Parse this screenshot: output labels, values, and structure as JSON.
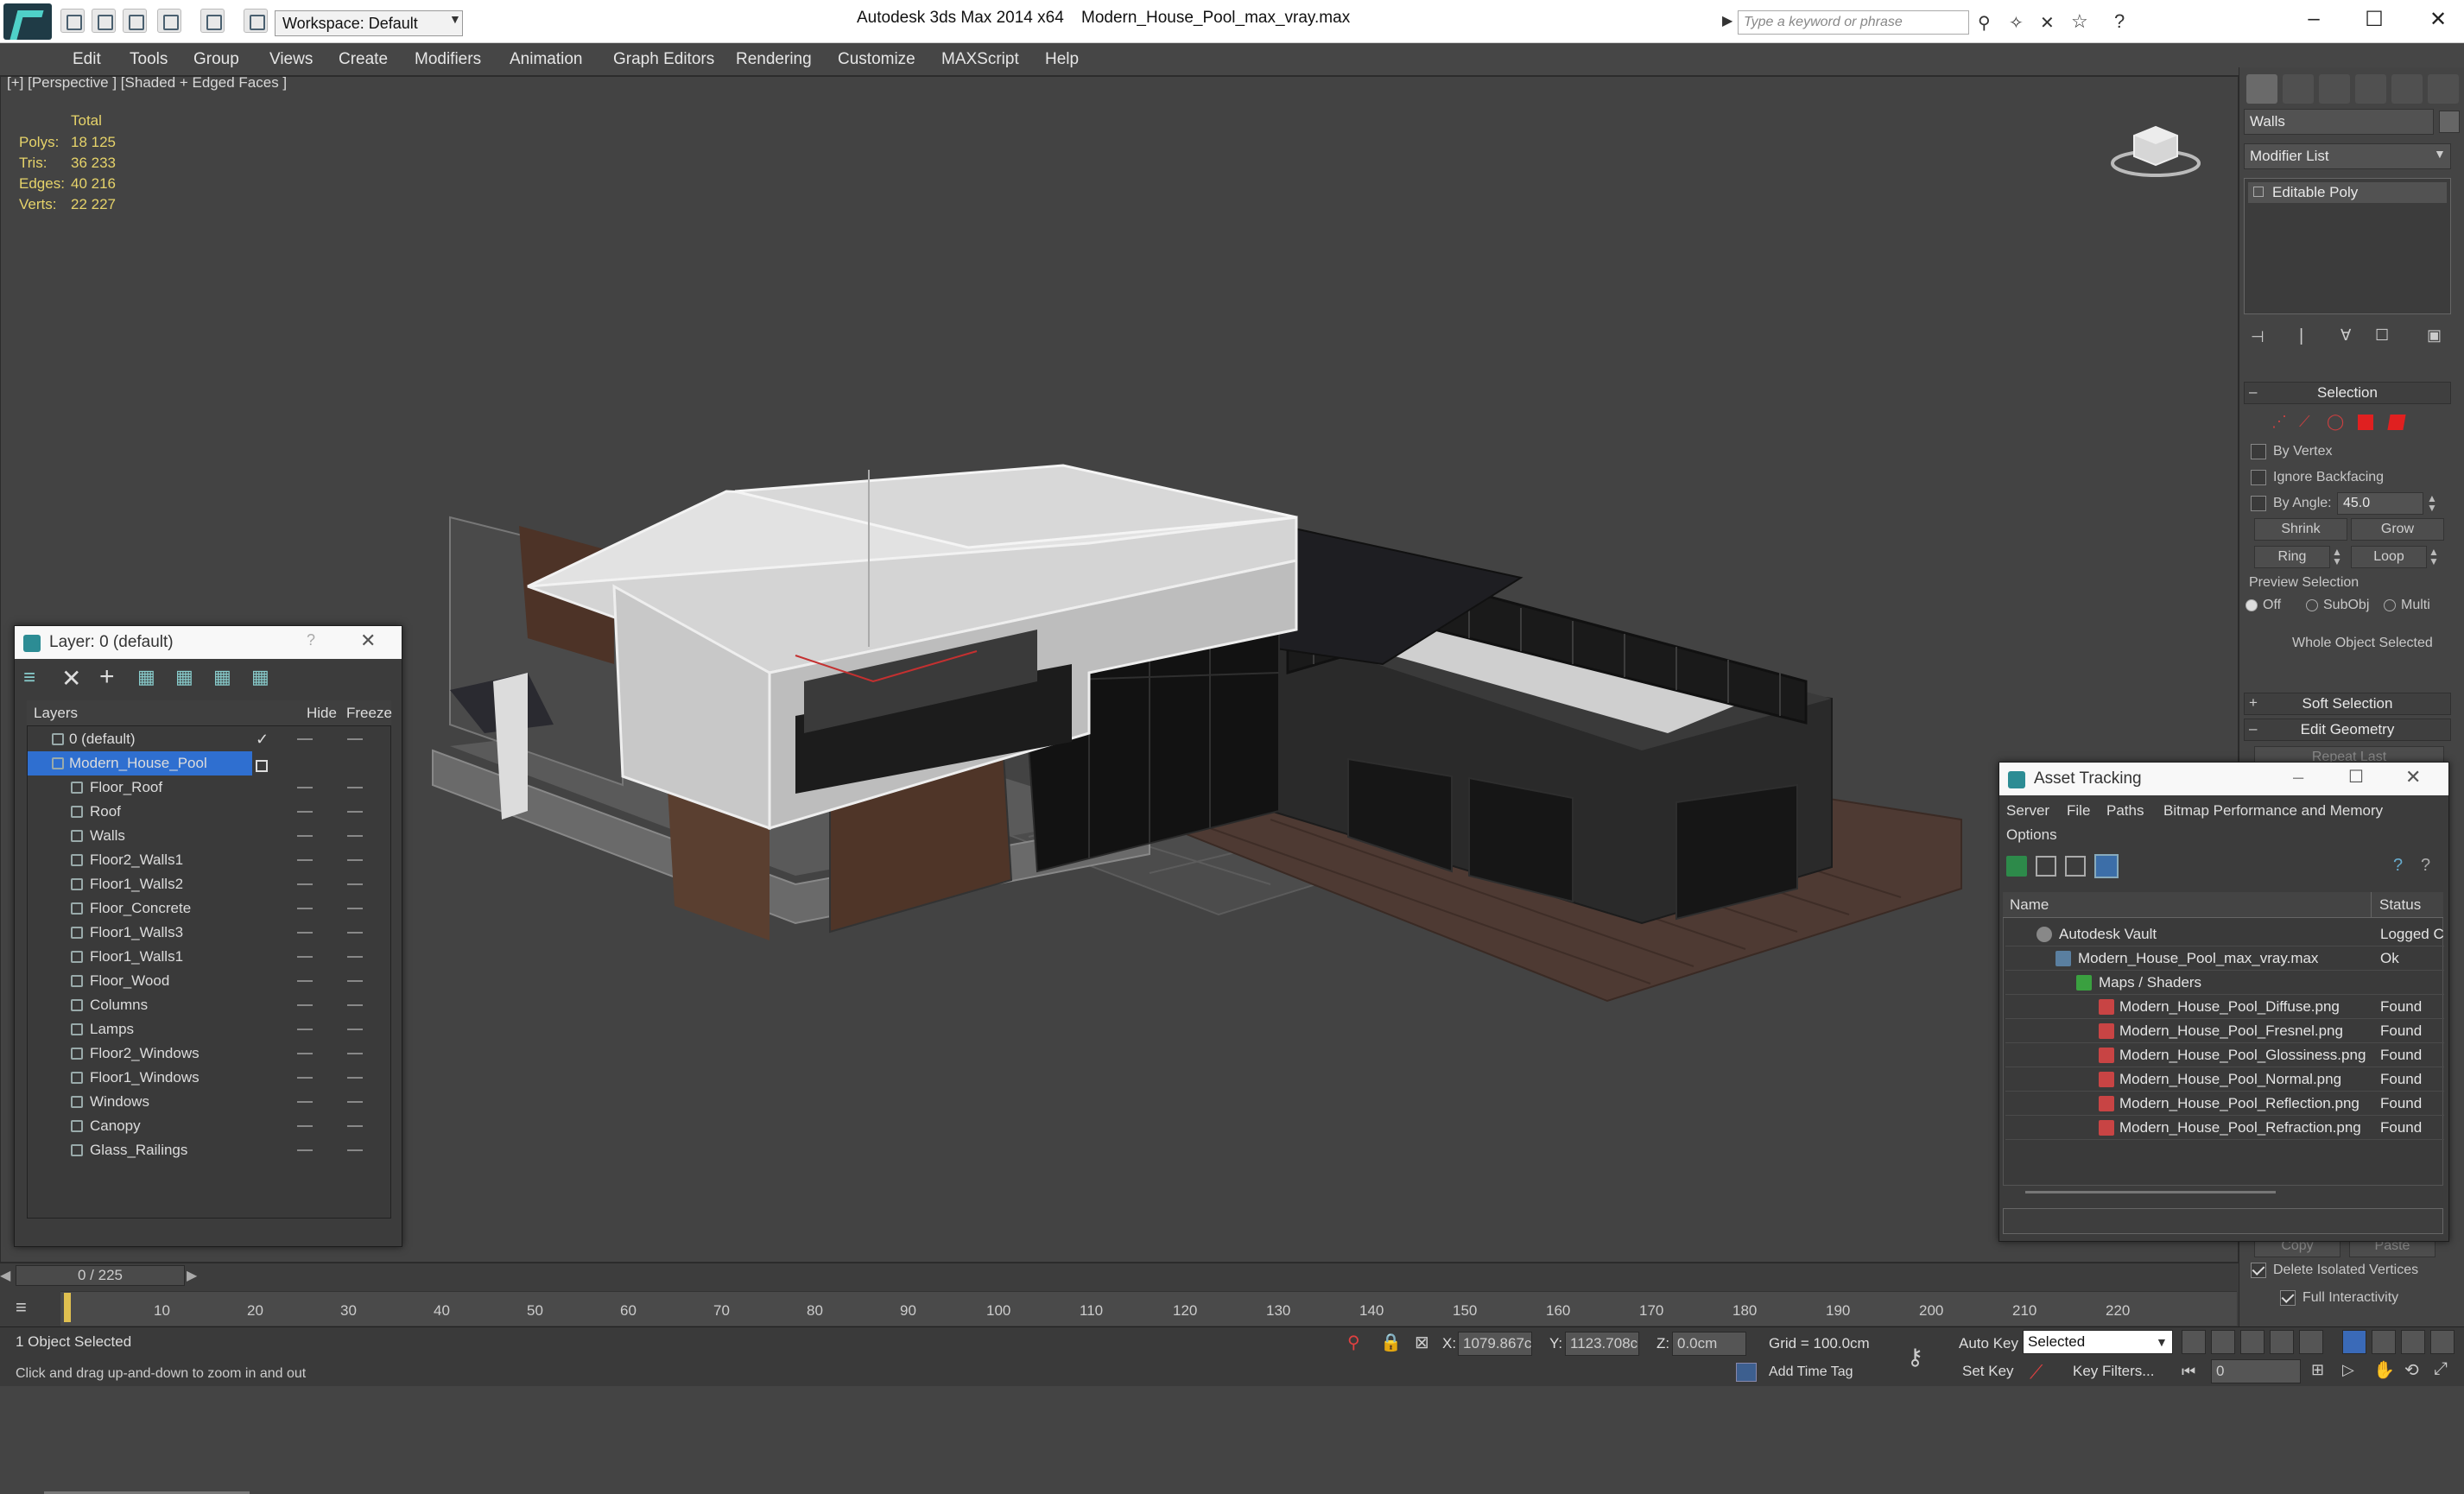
{
  "app": {
    "title": "Autodesk 3ds Max  2014 x64",
    "file": "Modern_House_Pool_max_vray.max",
    "workspace": "Workspace: Default",
    "search_placeholder": "Type a keyword or phrase"
  },
  "menu": [
    "Edit",
    "Tools",
    "Group",
    "Views",
    "Create",
    "Modifiers",
    "Animation",
    "Graph Editors",
    "Rendering",
    "Customize",
    "MAXScript",
    "Help"
  ],
  "viewport": {
    "label": "[+] [Perspective ] [Shaded + Edged Faces ]",
    "stats_header": "Total",
    "stats": [
      {
        "label": "Polys:",
        "value": "18 125"
      },
      {
        "label": "Tris:",
        "value": "36 233"
      },
      {
        "label": "Edges:",
        "value": "40 216"
      },
      {
        "label": "Verts:",
        "value": "22 227"
      }
    ]
  },
  "layer_dialog": {
    "title": "Layer: 0 (default)",
    "help": "?",
    "col_layers": "Layers",
    "col_hide": "Hide",
    "col_freeze": "Freeze",
    "rows": [
      {
        "name": "0 (default)"
      },
      {
        "name": "Modern_House_Pool"
      },
      {
        "name": "Floor_Roof"
      },
      {
        "name": "Roof"
      },
      {
        "name": "Walls"
      },
      {
        "name": "Floor2_Walls1"
      },
      {
        "name": "Floor1_Walls2"
      },
      {
        "name": "Floor_Concrete"
      },
      {
        "name": "Floor1_Walls3"
      },
      {
        "name": "Floor1_Walls1"
      },
      {
        "name": "Floor_Wood"
      },
      {
        "name": "Columns"
      },
      {
        "name": "Lamps"
      },
      {
        "name": "Floor2_Windows"
      },
      {
        "name": "Floor1_Windows"
      },
      {
        "name": "Windows"
      },
      {
        "name": "Canopy"
      },
      {
        "name": "Glass_Railings"
      }
    ]
  },
  "command_panel": {
    "object_name": "Walls",
    "modifier_list": "Modifier List",
    "stack_item": "Editable Poly",
    "selection_title": "Selection",
    "by_vertex": "By Vertex",
    "ignore_backfacing": "Ignore Backfacing",
    "by_angle": "By Angle:",
    "angle_value": "45.0",
    "shrink": "Shrink",
    "grow": "Grow",
    "ring": "Ring",
    "loop": "Loop",
    "preview_selection": "Preview Selection",
    "preview_off": "Off",
    "preview_subobj": "SubObj",
    "preview_multi": "Multi",
    "whole_object": "Whole Object Selected",
    "soft_selection": "Soft Selection",
    "edit_geometry": "Edit Geometry",
    "repeat_last": "Repeat Last",
    "copy": "Copy",
    "paste": "Paste",
    "delete_isolated": "Delete Isolated Vertices",
    "full_interactivity": "Full Interactivity"
  },
  "asset_tracking": {
    "title": "Asset Tracking",
    "menu": [
      "Server",
      "File",
      "Paths",
      "Bitmap Performance and Memory"
    ],
    "options": "Options",
    "col_name": "Name",
    "col_status": "Status",
    "rows": [
      {
        "name": "Autodesk Vault",
        "status": "Logged C"
      },
      {
        "name": "Modern_House_Pool_max_vray.max",
        "status": "Ok"
      },
      {
        "name": "Maps / Shaders",
        "status": ""
      },
      {
        "name": "Modern_House_Pool_Diffuse.png",
        "status": "Found"
      },
      {
        "name": "Modern_House_Pool_Fresnel.png",
        "status": "Found"
      },
      {
        "name": "Modern_House_Pool_Glossiness.png",
        "status": "Found"
      },
      {
        "name": "Modern_House_Pool_Normal.png",
        "status": "Found"
      },
      {
        "name": "Modern_House_Pool_Reflection.png",
        "status": "Found"
      },
      {
        "name": "Modern_House_Pool_Refraction.png",
        "status": "Found"
      }
    ]
  },
  "timeline": {
    "frame": "0 / 225",
    "ticks": [
      "10",
      "20",
      "30",
      "40",
      "50",
      "60",
      "70",
      "80",
      "90",
      "100",
      "110",
      "120",
      "130",
      "140",
      "150",
      "160",
      "170",
      "180",
      "190",
      "200",
      "210",
      "220"
    ]
  },
  "status": {
    "selected": "1 Object Selected",
    "hint": "Click and drag up-and-down to zoom in and out",
    "x_label": "X:",
    "x_value": "1079.867c",
    "y_label": "Y:",
    "y_value": "1123.708c",
    "z_label": "Z:",
    "z_value": "0.0cm",
    "grid": "Grid = 100.0cm",
    "auto_key": "Auto Key",
    "selected_dropdown": "Selected",
    "set_key": "Set Key",
    "key_filters": "Key Filters...",
    "add_time_tag": "Add Time Tag",
    "frame_value": "0"
  }
}
